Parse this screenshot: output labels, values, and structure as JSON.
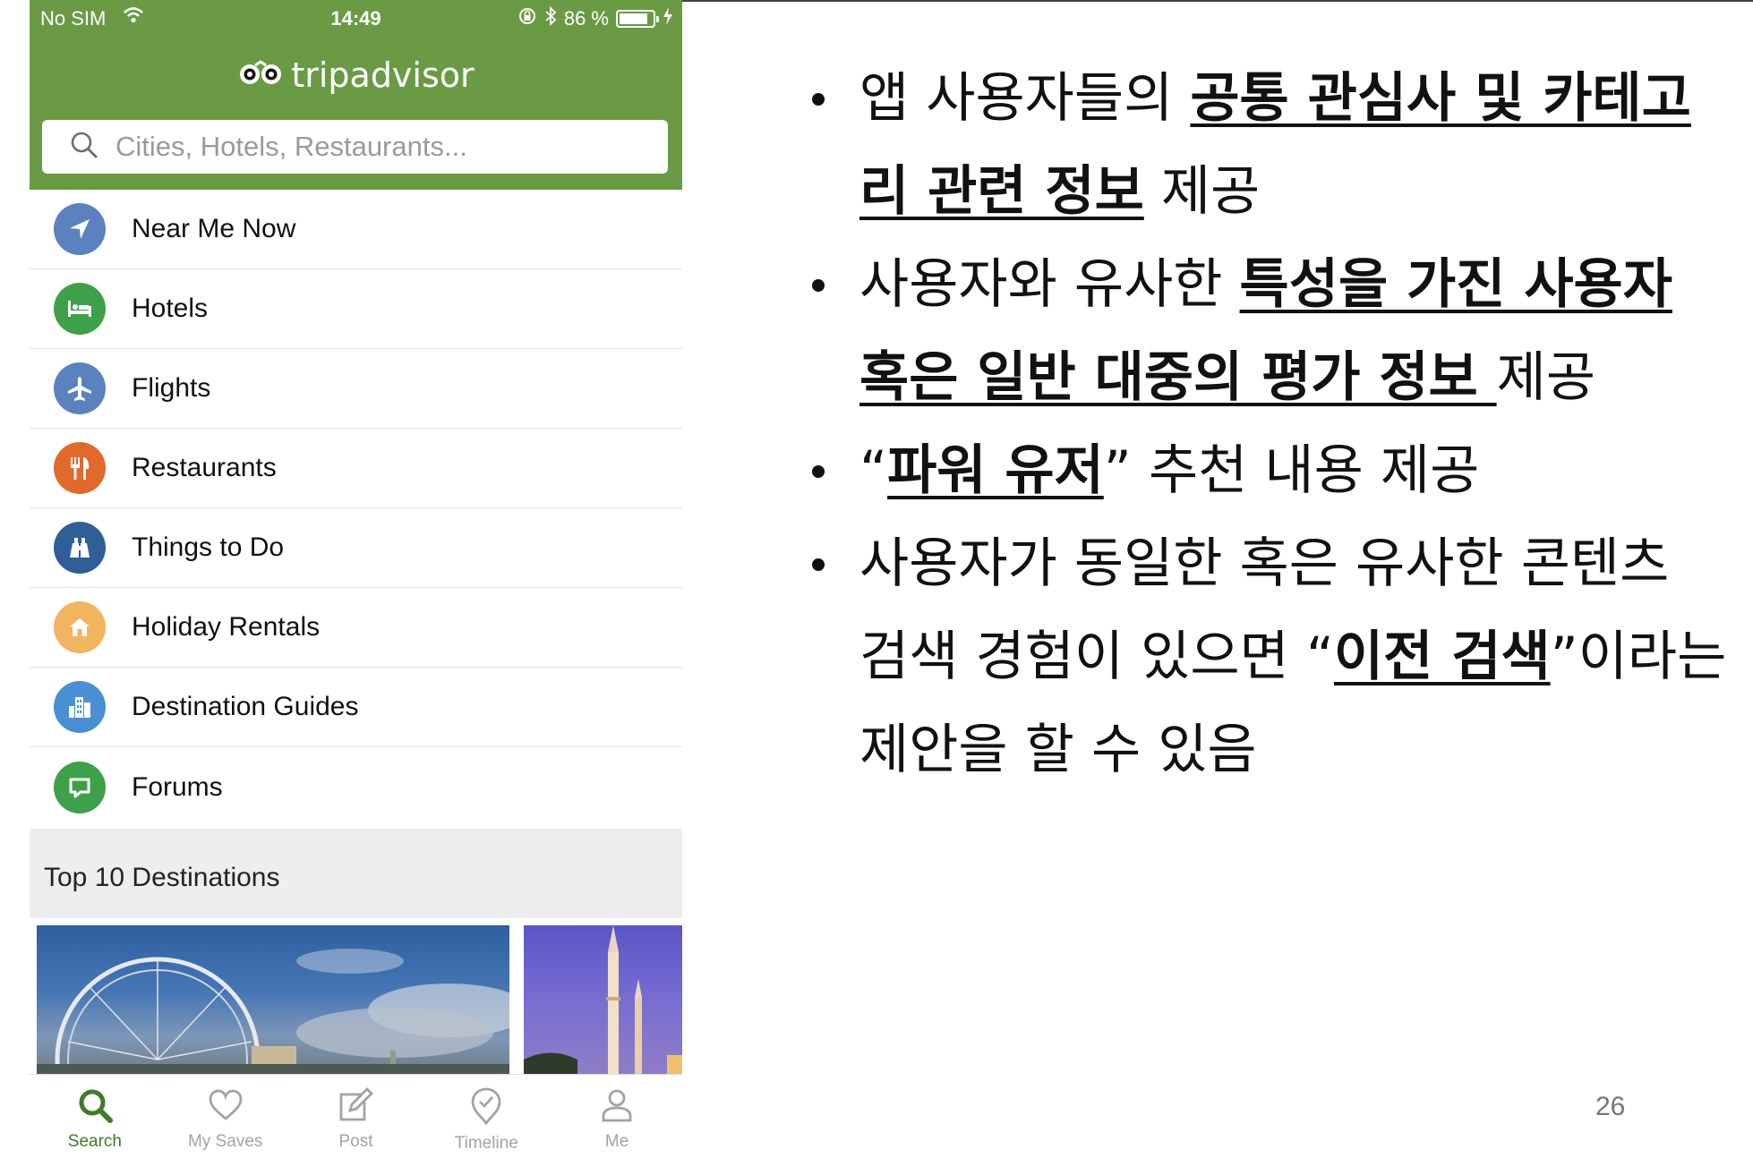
{
  "colors": {
    "header_green": "#6b9a45",
    "tab_active": "#3f7b2e",
    "tab_inactive": "#a3a3a3"
  },
  "status_bar": {
    "carrier": "No SIM",
    "time": "14:49",
    "battery": "86 %",
    "battery_level": 0.86
  },
  "app": {
    "logo_text": "tripadvisor"
  },
  "search": {
    "placeholder": "Cities, Hotels, Restaurants..."
  },
  "menu": [
    {
      "label": "Near Me Now",
      "icon": "location-arrow-icon",
      "color": "#5b82be"
    },
    {
      "label": "Hotels",
      "icon": "bed-icon",
      "color": "#3fa04a"
    },
    {
      "label": "Flights",
      "icon": "plane-icon",
      "color": "#5b82be"
    },
    {
      "label": "Restaurants",
      "icon": "fork-knife-icon",
      "color": "#e0692b"
    },
    {
      "label": "Things to Do",
      "icon": "binoculars-icon",
      "color": "#2e5f96"
    },
    {
      "label": "Holiday Rentals",
      "icon": "house-icon",
      "color": "#f2b55f"
    },
    {
      "label": "Destination Guides",
      "icon": "city-icon",
      "color": "#4a8fd3"
    },
    {
      "label": "Forums",
      "icon": "speech-bubble-icon",
      "color": "#3fa04a"
    }
  ],
  "section": {
    "title": "Top 10 Destinations"
  },
  "tabs": [
    {
      "label": "Search",
      "icon": "search-icon",
      "active": true
    },
    {
      "label": "My Saves",
      "icon": "heart-icon",
      "active": false
    },
    {
      "label": "Post",
      "icon": "edit-icon",
      "active": false
    },
    {
      "label": "Timeline",
      "icon": "timeline-pin-icon",
      "active": false
    },
    {
      "label": "Me",
      "icon": "user-icon",
      "active": false
    }
  ],
  "slide": {
    "b1": {
      "a": "앱 사용자들의 ",
      "b": "공통 관심사 및 카테고",
      "c": "리 관련 정보",
      "d": " 제공"
    },
    "b2": {
      "a": "사용자와 유사한 ",
      "b": "특성을 가진 사용자",
      "c": "혹은 일반 대중의 평가 정보 ",
      "d": "제공"
    },
    "b3": {
      "a": "“",
      "b": "파워 유저",
      "c": "” 추천 내용 제공"
    },
    "b4": {
      "a": "사용자가 동일한 혹은 유사한 콘텐츠",
      "b": "검색 경험이 있으면 “",
      "c": "이전 검색",
      "d": "”이라는",
      "e": "제안을 할 수 있음"
    },
    "page_number": "26"
  }
}
